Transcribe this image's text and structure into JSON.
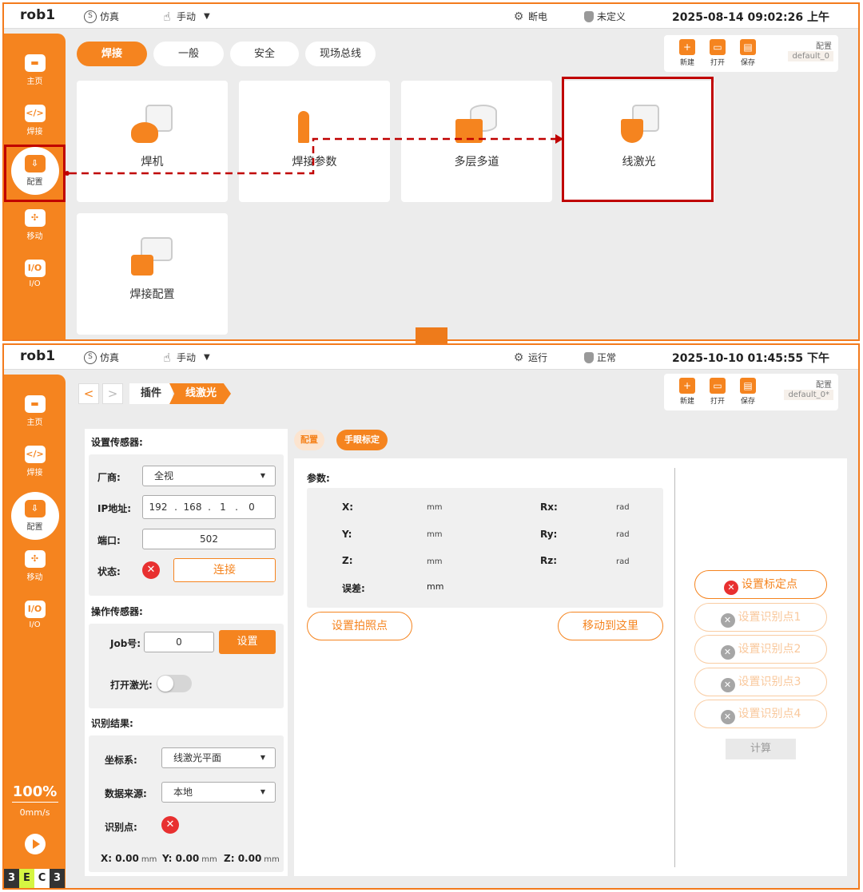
{
  "top": {
    "topbar": {
      "robot_name": "rob1",
      "mode_icon_text": "S",
      "mode": "仿真",
      "control": "手动",
      "power": "断电",
      "safety": "未定义",
      "datetime": "2025-08-14 09:02:26 上午"
    },
    "nav": [
      {
        "label": "主页",
        "icon": "home-icon"
      },
      {
        "label": "焊接",
        "icon": "code-icon",
        "glyph": "</>"
      },
      {
        "label": "配置",
        "icon": "config-icon"
      },
      {
        "label": "移动",
        "icon": "move-icon",
        "glyph": "✣"
      },
      {
        "label": "I/O",
        "icon": "io-icon",
        "glyph": "I/O"
      }
    ],
    "tabs": [
      "焊接",
      "一般",
      "安全",
      "现场总线"
    ],
    "file_actions": {
      "new": "新建",
      "open": "打开",
      "save": "保存",
      "config_label": "配置",
      "config_value": "default_0"
    },
    "cards": [
      {
        "label": "焊机",
        "icon": "welder-icon"
      },
      {
        "label": "焊接参数",
        "icon": "weld-params-icon"
      },
      {
        "label": "多层多道",
        "icon": "multilayer-icon"
      },
      {
        "label": "线激光",
        "icon": "line-laser-icon"
      },
      {
        "label": "焊接配置",
        "icon": "weld-config-icon"
      }
    ]
  },
  "bottom": {
    "topbar": {
      "robot_name": "rob1",
      "mode_icon_text": "S",
      "mode": "仿真",
      "control": "手动",
      "run_state": "运行",
      "safety": "正常",
      "datetime": "2025-10-10 01:45:55 下午"
    },
    "nav": [
      {
        "label": "主页"
      },
      {
        "label": "焊接",
        "glyph": "</>"
      },
      {
        "label": "配置"
      },
      {
        "label": "移动",
        "glyph": "✣"
      },
      {
        "label": "I/O",
        "glyph": "I/O"
      }
    ],
    "speed": {
      "percent": "100%",
      "velocity": "0mm/s"
    },
    "ec_badge": [
      "3",
      "E",
      "C",
      "3"
    ],
    "breadcrumb": {
      "back": "<",
      "forward": ">",
      "parent": "插件",
      "current": "线激光"
    },
    "file_actions": {
      "new": "新建",
      "open": "打开",
      "save": "保存",
      "config_label": "配置",
      "config_value": "default_0*"
    },
    "left": {
      "setup_title": "设置传感器:",
      "vendor_label": "厂商:",
      "vendor_value": "全视",
      "ip_label": "IP地址:",
      "ip": [
        "192",
        "168",
        "1",
        "0"
      ],
      "ip_dot": ".",
      "port_label": "端口:",
      "port_value": "502",
      "status_label": "状态:",
      "status_mark": "✕",
      "connect": "连接",
      "operate_title": "操作传感器:",
      "job_label": "Job号:",
      "job_value": "0",
      "set": "设置",
      "laser_label": "打开激光:",
      "laser_on": false,
      "result_title": "识别结果:",
      "coord_label": "坐标系:",
      "coord_value": "线激光平面",
      "source_label": "数据来源:",
      "source_value": "本地",
      "points_label": "识别点:",
      "points_mark": "✕",
      "xyz": [
        {
          "axis": "X:",
          "value": "0.00",
          "unit": "mm"
        },
        {
          "axis": "Y:",
          "value": "0.00",
          "unit": "mm"
        },
        {
          "axis": "Z:",
          "value": "0.00",
          "unit": "mm"
        }
      ]
    },
    "ptabs": {
      "config": "配置",
      "calib": "手眼标定"
    },
    "params": {
      "title": "参数:",
      "rows": [
        {
          "l": "X:",
          "lu": "mm",
          "r": "Rx:",
          "ru": "rad"
        },
        {
          "l": "Y:",
          "lu": "mm",
          "r": "Ry:",
          "ru": "rad"
        },
        {
          "l": "Z:",
          "lu": "mm",
          "r": "Rz:",
          "ru": "rad"
        }
      ],
      "error_label": "误差:",
      "error_unit": "mm",
      "photo_btn": "设置拍照点",
      "move_btn": "移动到这里"
    },
    "right": {
      "mark": "✕",
      "buttons": [
        "设置标定点",
        "设置识别点1",
        "设置识别点2",
        "设置识别点3",
        "设置识别点4"
      ],
      "calc": "计算"
    }
  },
  "colors": {
    "accent": "#f5841f",
    "highlight": "#c00000",
    "error": "#e83030"
  }
}
